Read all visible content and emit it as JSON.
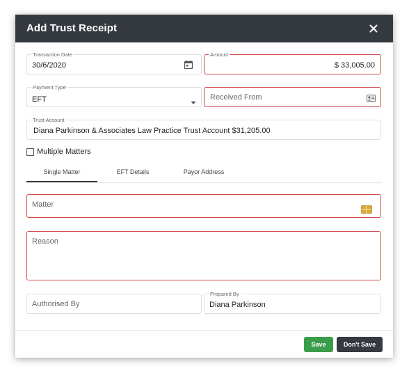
{
  "dialog": {
    "title": "Add Trust Receipt"
  },
  "form": {
    "transaction_date": {
      "label": "Transaction Date",
      "value": "30/6/2020"
    },
    "amount": {
      "label": "Amount",
      "value": "$ 33,005.00"
    },
    "payment_type": {
      "label": "Payment Type",
      "value": "EFT"
    },
    "received_from": {
      "placeholder": "Received From"
    },
    "trust_account": {
      "label": "Trust Account",
      "value": "Diana Parkinson & Associates Law Practice Trust Account  $31,205.00"
    },
    "multiple_matters": {
      "label": "Multiple Matters",
      "checked": false
    },
    "matter": {
      "placeholder": "Matter"
    },
    "reason": {
      "placeholder": "Reason"
    },
    "authorised_by": {
      "placeholder": "Authorised By"
    },
    "prepared_by": {
      "label": "Prepared By",
      "value": "Diana Parkinson"
    }
  },
  "tabs": [
    {
      "label": "Single Matter",
      "active": true
    },
    {
      "label": "EFT Details",
      "active": false
    },
    {
      "label": "Payor Address",
      "active": false
    }
  ],
  "buttons": {
    "save": "Save",
    "dont_save": "Don't Save"
  },
  "colors": {
    "header_bg": "#343a40",
    "error_border": "#d24a4a",
    "save_green": "#3b9c4c"
  },
  "icons": {
    "close": "close-icon",
    "calendar": "calendar-icon",
    "dropdown": "caret-down-icon",
    "contact_card": "contact-card-icon",
    "matter_picker": "folder-grid-icon"
  }
}
